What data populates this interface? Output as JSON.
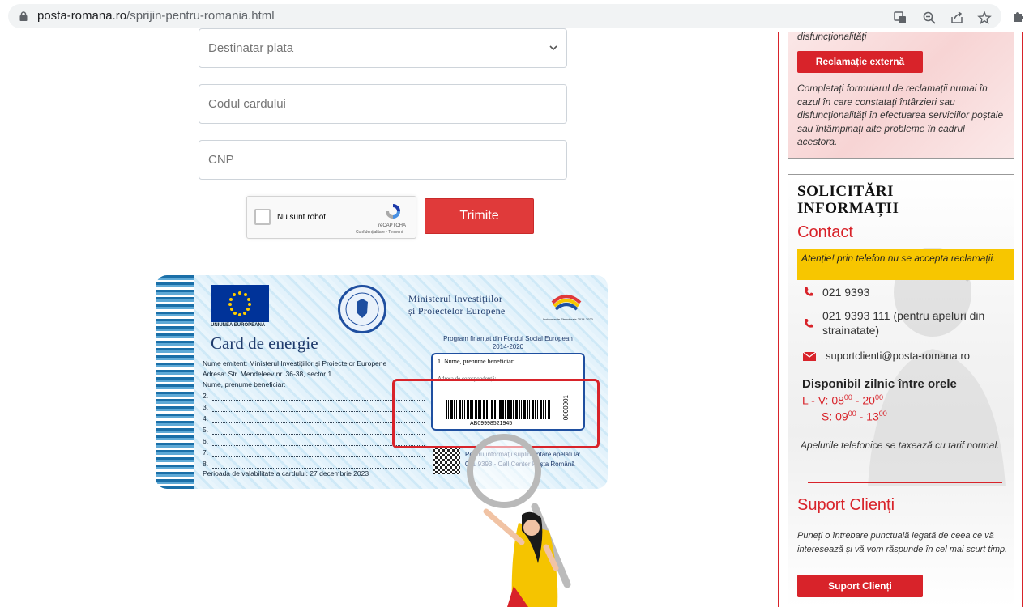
{
  "browser": {
    "url_host": "posta-romana.ro",
    "url_path": "/sprijin-pentru-romania.html"
  },
  "form": {
    "destinatar_placeholder": "Destinatar plata",
    "cod_card_placeholder": "Codul cardului",
    "cnp_placeholder": "CNP",
    "captcha_label": "Nu sunt robot",
    "captcha_brand": "reCAPTCHA",
    "captcha_terms": "Confidențialitate - Termeni",
    "submit_label": "Trimite"
  },
  "card": {
    "eu_text": "UNIUNEA EUROPEANĂ",
    "ministry_line1": "Ministerul Investițiilor",
    "ministry_line2": "și Proiectelor Europene",
    "struct_text": "Instrumente Structurale 2014-2020",
    "title": "Card de energie",
    "program_line1": "Program finanțat din Fondul Social European",
    "program_line2": "2014-2020",
    "emitent": "Nume emitent: Ministerul Investițiilor și Proiectelor Europene",
    "adresa": "Adresa: Str. Mendeleev nr. 36-38, sector 1",
    "nume_label": "Nume, prenume beneficiar:",
    "rows": [
      "2.",
      "3.",
      "4.",
      "5.",
      "6.",
      "7.",
      "8."
    ],
    "validity": "Perioada de valabilitate a cardului: 27 decembrie 2023",
    "benef_label": "1. Nume, prenume beneficiar:",
    "addr_label": "Adresa de corespondență:",
    "barcode_number": "AB09998521945",
    "serial": "0000001",
    "info_line1": "Pentru informații suplimentare apelați la:",
    "info_line2": "021 9393 - Call Center Poșta Română"
  },
  "sidebar": {
    "prev_text": "disfuncționalități",
    "reclamatie_button": "Reclamație externă",
    "reclamatie_desc": "Completați formularul de reclamații numai în cazul în care constatați întârzieri sau disfuncționalități în efectuarea serviciilor poștale sau întâmpinați alte probleme în cadrul acestora.",
    "solicitari_title": "SOLICITĂRI INFORMAȚII",
    "contact_title": "Contact",
    "warning": "Atenție! prin telefon nu se accepta reclamații.",
    "phone1": "021 9393",
    "phone2_line1": "021 9393 111 (pentru apeluri din",
    "phone2_line2": "strainatate)",
    "email": "suportclienti@posta-romana.ro",
    "availability_title": "Disponibil zilnic între orele",
    "hours_week_label": "L - V:",
    "hours_week_start": "08",
    "hours_week_end": "20",
    "hours_sat_label": "S:",
    "hours_sat_start": "09",
    "hours_sat_end": "13",
    "hours_sup": "00",
    "tarif_note": "Apelurile telefonice se taxează cu tarif normal.",
    "suport_title": "Suport Clienți",
    "suport_desc": "Puneți o întrebare punctuală legată de ceea ce vă interesează și vă vom răspunde în cel mai scurt timp.",
    "suport_button": "Suport Clienți"
  },
  "colors": {
    "brand_red": "#d8232a",
    "warning_yellow": "#f7c600",
    "card_blue": "#1f4fa0"
  }
}
